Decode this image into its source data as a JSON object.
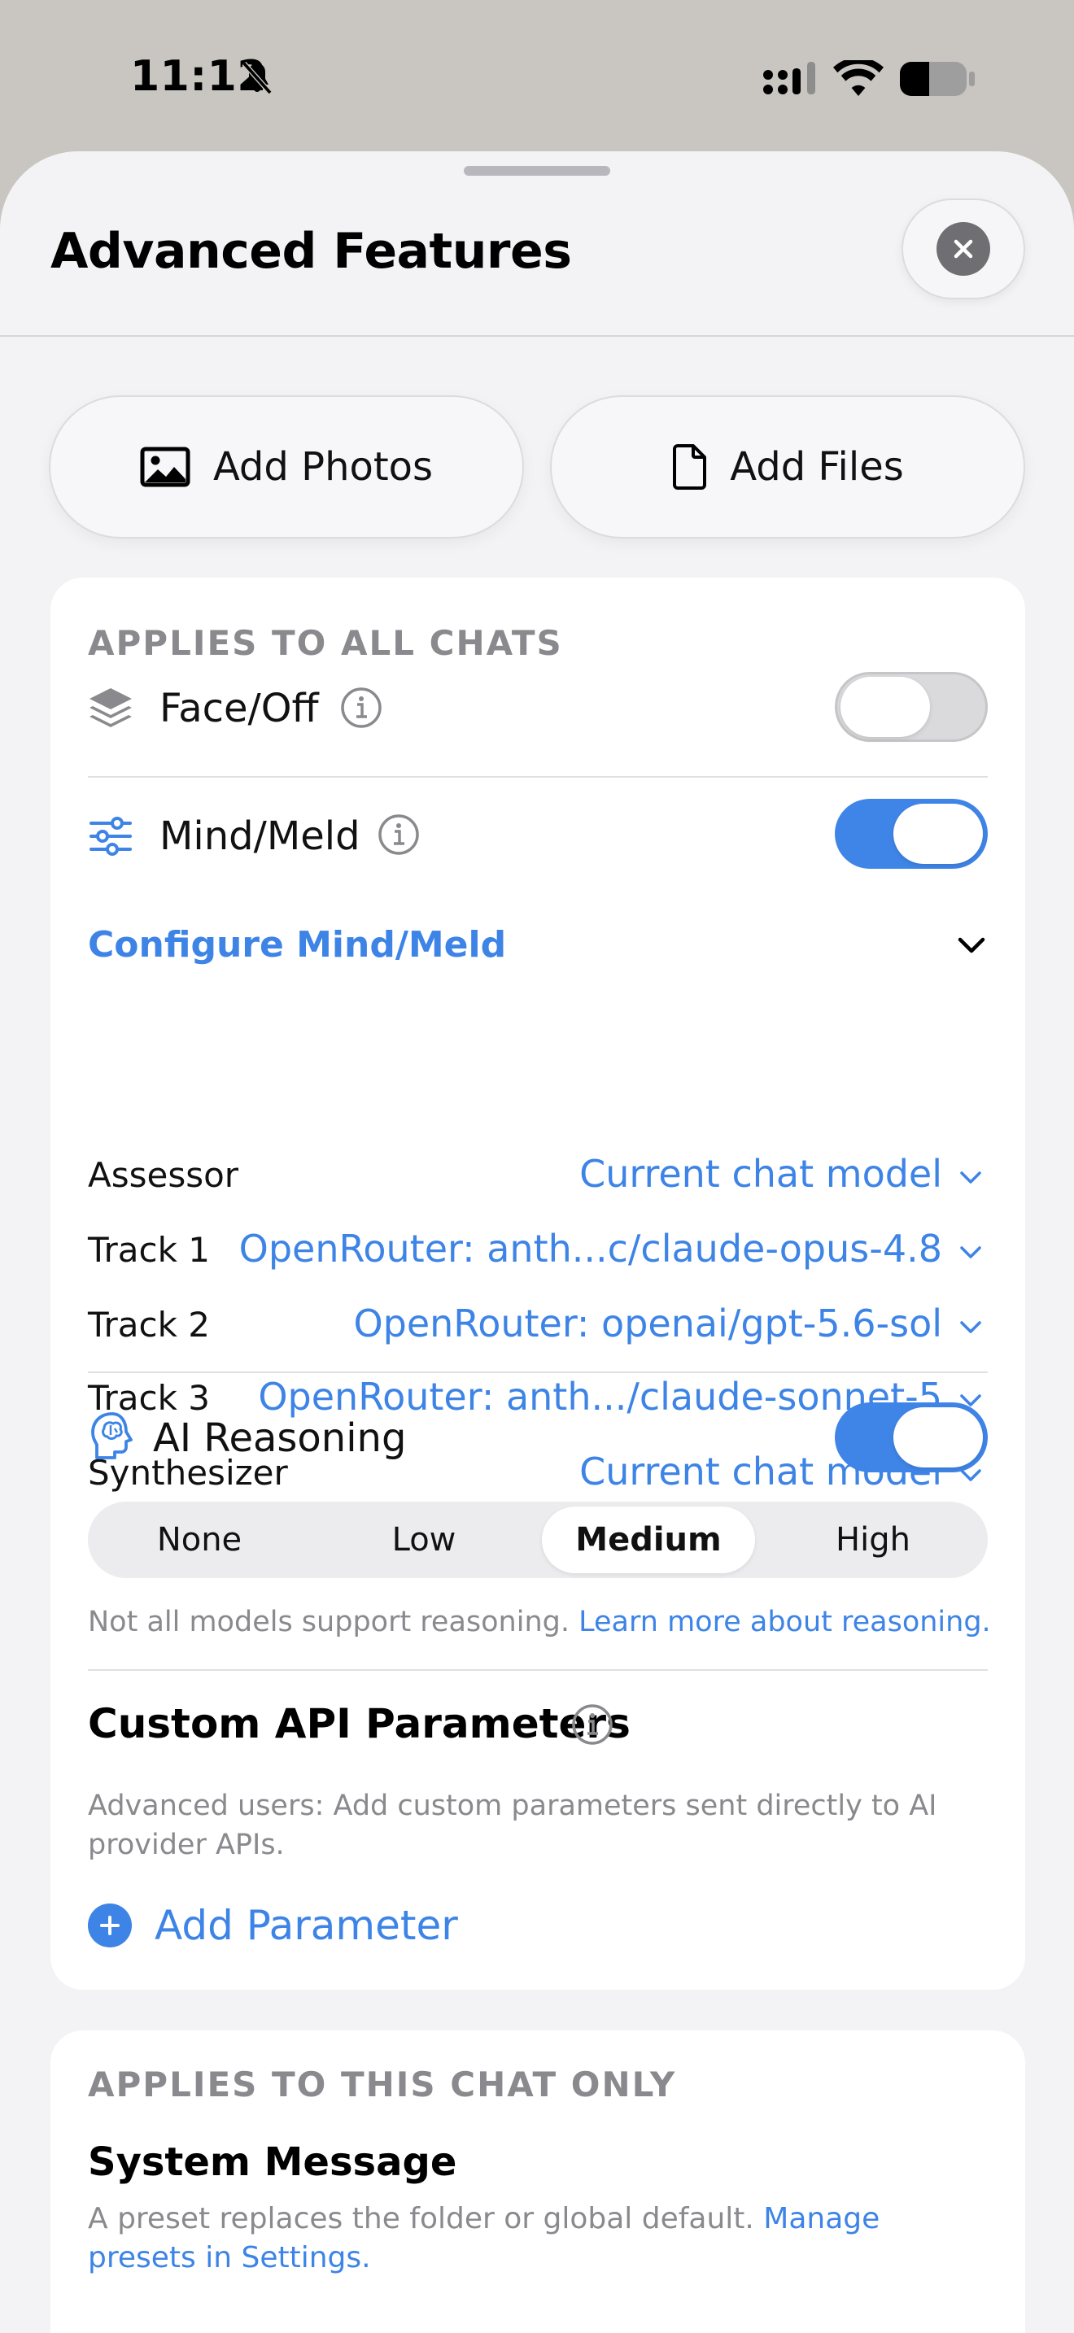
{
  "status_bar": {
    "time": "11:12",
    "icons": [
      "bell-slash-icon",
      "cellular-signal-icon",
      "wifi-icon",
      "battery-icon"
    ]
  },
  "sheet": {
    "title": "Advanced Features",
    "close_icon": "xmark-icon"
  },
  "quick_actions": {
    "add_photos": "Add Photos",
    "add_files": "Add Files"
  },
  "global_section": {
    "header": "APPLIES TO ALL CHATS",
    "face_off": {
      "label": "Face/Off",
      "enabled": false
    },
    "mind_meld": {
      "label": "Mind/Meld",
      "enabled": true
    },
    "configure": {
      "label": "Configure Mind/Meld",
      "rows": [
        {
          "name": "Assessor",
          "value": "Current chat model"
        },
        {
          "name": "Track 1",
          "value": "OpenRouter: anth...c/claude-opus-4.8"
        },
        {
          "name": "Track 2",
          "value": "OpenRouter: openai/gpt-5.6-sol"
        },
        {
          "name": "Track 3",
          "value": "OpenRouter: anth.../claude-sonnet-5"
        },
        {
          "name": "Synthesizer",
          "value": "Current chat model"
        }
      ]
    },
    "ai_reasoning": {
      "label": "AI Reasoning",
      "enabled": true,
      "levels": [
        "None",
        "Low",
        "Medium",
        "High"
      ],
      "selected": "Medium",
      "note": "Not all models support reasoning.",
      "note_link": "Learn more about reasoning."
    },
    "custom_params": {
      "title": "Custom API Parameters",
      "description": "Advanced users: Add custom parameters sent directly to AI provider APIs.",
      "add_label": "Add Parameter"
    }
  },
  "chat_section": {
    "header": "APPLIES TO THIS CHAT ONLY",
    "system_message_title": "System Message",
    "note": "A preset replaces the folder or global default.",
    "note_link": "Manage presets in Settings."
  },
  "colors": {
    "accent": "#3d84e6",
    "toggle_on": "#3f85e8",
    "secondary_text": "#8a8a8e",
    "sheet_bg": "#f3f3f5"
  }
}
